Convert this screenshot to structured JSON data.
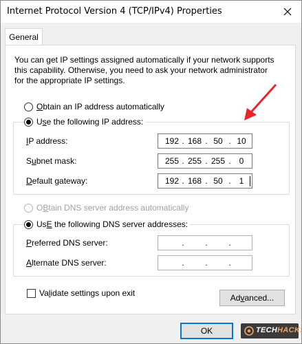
{
  "window": {
    "title": "Internet Protocol Version 4 (TCP/IPv4) Properties"
  },
  "tabs": [
    {
      "label": "General"
    }
  ],
  "intro_text": [
    "You can get IP settings assigned automatically if your network supports",
    "this capability. Otherwise, you need to ask your network administrator",
    "for the appropriate IP settings."
  ],
  "ip_mode": {
    "auto": {
      "mnemonic": "O",
      "rest": "btain an IP address automatically",
      "selected": false
    },
    "manual": {
      "mnemonic": "s",
      "pre": "U",
      "rest": "e the following IP address:",
      "selected": true
    }
  },
  "ip_fields": {
    "ip_address": {
      "mnemonic": "I",
      "rest": "P address:",
      "octets": [
        "192",
        "168",
        "50",
        "10"
      ]
    },
    "subnet_mask": {
      "pre": "S",
      "mnemonic": "u",
      "rest": "bnet mask:",
      "octets": [
        "255",
        "255",
        "255",
        "0"
      ]
    },
    "default_gateway": {
      "mnemonic": "D",
      "rest": "efault gateway:",
      "octets": [
        "192",
        "168",
        "50",
        "1"
      ]
    }
  },
  "dns_mode": {
    "auto": {
      "mnemonic": "B",
      "pre": "O",
      "rest": "tain DNS server address automatically",
      "selected": false,
      "disabled": true
    },
    "manual": {
      "mnemonic": "E",
      "pre": "Us",
      "rest": " the following DNS server addresses:",
      "selected": true
    }
  },
  "dns_fields": {
    "preferred": {
      "mnemonic": "P",
      "rest": "referred DNS server:",
      "octets": [
        "",
        "",
        "",
        ""
      ]
    },
    "alternate": {
      "mnemonic": "A",
      "rest": "lternate DNS server:",
      "octets": [
        "",
        "",
        "",
        ""
      ]
    }
  },
  "validate": {
    "pre": "Va",
    "mnemonic": "l",
    "rest": "idate settings upon exit",
    "checked": false
  },
  "buttons": {
    "advanced_pre": "Ad",
    "advanced_mnemonic": "v",
    "advanced_rest": "anced...",
    "ok": "OK"
  },
  "watermark": {
    "part1": "TECH",
    "part2": "HACKS"
  },
  "colors": {
    "accent": "#0078d7",
    "annotation_arrow": "#e8262a"
  }
}
